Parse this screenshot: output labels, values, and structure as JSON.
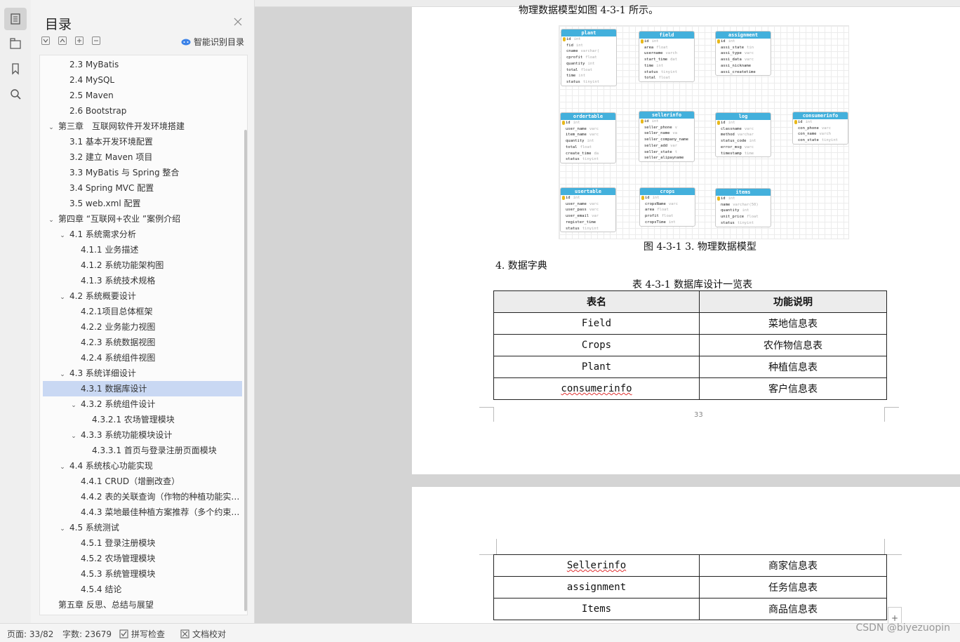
{
  "toc": {
    "title": "目录",
    "smart_label": "智能识别目录",
    "items": [
      {
        "label": "2.3 MyBatis",
        "level": 2,
        "expand": ""
      },
      {
        "label": "2.4 MySQL",
        "level": 2,
        "expand": ""
      },
      {
        "label": "2.5 Maven",
        "level": 2,
        "expand": ""
      },
      {
        "label": "2.6 Bootstrap",
        "level": 2,
        "expand": ""
      },
      {
        "label": "第三章　互联网软件开发环境搭建",
        "level": 1,
        "expand": "open"
      },
      {
        "label": "3.1  基本开发环境配置",
        "level": 2,
        "expand": ""
      },
      {
        "label": "3.2  建立 Maven 项目",
        "level": 2,
        "expand": ""
      },
      {
        "label": "3.3 MyBatis 与 Spring 整合",
        "level": 2,
        "expand": ""
      },
      {
        "label": "3.4   Spring MVC 配置",
        "level": 2,
        "expand": ""
      },
      {
        "label": "3.5 web.xml 配置",
        "level": 2,
        "expand": ""
      },
      {
        "label": "第四章  “互联网+农业 ”案例介绍",
        "level": 1,
        "expand": "open"
      },
      {
        "label": "4.1  系统需求分析",
        "level": 2,
        "expand": "open"
      },
      {
        "label": "4.1.1  业务描述",
        "level": 3,
        "expand": ""
      },
      {
        "label": "4.1.2  系统功能架构图",
        "level": 3,
        "expand": ""
      },
      {
        "label": "4.1.3  系统技术规格",
        "level": 3,
        "expand": ""
      },
      {
        "label": "4.2  系统概要设计",
        "level": 2,
        "expand": "open"
      },
      {
        "label": "4.2.1项目总体框架",
        "level": 3,
        "expand": ""
      },
      {
        "label": "4.2.2  业务能力视图",
        "level": 3,
        "expand": ""
      },
      {
        "label": "4.2.3  系统数据视图",
        "level": 3,
        "expand": ""
      },
      {
        "label": "4.2.4  系统组件视图",
        "level": 3,
        "expand": ""
      },
      {
        "label": "4.3  系统详细设计",
        "level": 2,
        "expand": "open"
      },
      {
        "label": "4.3.1  数据库设计",
        "level": 3,
        "expand": "",
        "selected": true
      },
      {
        "label": "4.3.2  系统组件设计",
        "level": 3,
        "expand": "open"
      },
      {
        "label": "4.3.2.1 农场管理模块",
        "level": 4,
        "expand": ""
      },
      {
        "label": "4.3.3  系统功能模块设计",
        "level": 3,
        "expand": "open"
      },
      {
        "label": "4.3.3.1 首页与登录注册页面模块",
        "level": 4,
        "expand": ""
      },
      {
        "label": "4.4  系统核心功能实现",
        "level": 2,
        "expand": "open"
      },
      {
        "label": "4.4.1 CRUD（增删改查）",
        "level": 3,
        "expand": ""
      },
      {
        "label": "4.4.2 表的关联查询（作物的种植功能实现）",
        "level": 3,
        "expand": ""
      },
      {
        "label": "4.4.3 菜地最佳种植方案推荐（多个约束条件）",
        "level": 3,
        "expand": ""
      },
      {
        "label": "4.5  系统测试",
        "level": 2,
        "expand": "open"
      },
      {
        "label": "4.5.1  登录注册模块",
        "level": 3,
        "expand": ""
      },
      {
        "label": "4.5.2 农场管理模块",
        "level": 3,
        "expand": ""
      },
      {
        "label": "4.5.3 系统管理模块",
        "level": 3,
        "expand": ""
      },
      {
        "label": "4.5.4 结论",
        "level": 3,
        "expand": ""
      },
      {
        "label": "第五章  反思、总结与展望",
        "level": 1,
        "expand": ""
      }
    ]
  },
  "doc": {
    "top_text": "物理数据模型如图 4-3-1 所示。",
    "figure_caption": "图 4-3-1 3. 物理数据模型",
    "section_heading": "4. 数据字典",
    "table_caption": "表 4-3-1 数据库设计一览表",
    "table_headers": [
      "表名",
      "功能说明"
    ],
    "table_rows_p1": [
      {
        "name": "Field",
        "desc": "菜地信息表"
      },
      {
        "name": "Crops",
        "desc": "农作物信息表"
      },
      {
        "name": "Plant",
        "desc": "种植信息表"
      },
      {
        "name": "consumerinfo",
        "desc": "客户信息表"
      }
    ],
    "table_rows_p2": [
      {
        "name": "Sellerinfo",
        "desc": "商家信息表"
      },
      {
        "name": "assignment",
        "desc": "任务信息表"
      },
      {
        "name": "Items",
        "desc": "商品信息表"
      }
    ],
    "page_number": "33",
    "er_tables": [
      {
        "name": "plant",
        "fields": [
          [
            "id",
            "int"
          ],
          [
            "fid",
            "int"
          ],
          [
            "cname",
            "varchar("
          ],
          [
            "cprofit",
            "float"
          ],
          [
            "quantity",
            "int"
          ],
          [
            "total",
            "float"
          ],
          [
            "time",
            "int"
          ],
          [
            "status",
            "tinyint"
          ]
        ]
      },
      {
        "name": "field",
        "fields": [
          [
            "id",
            "int"
          ],
          [
            "area",
            "float"
          ],
          [
            "username",
            "varch"
          ],
          [
            "start_time",
            "dat"
          ],
          [
            "time",
            "int"
          ],
          [
            "status",
            "tinyint"
          ],
          [
            "total",
            "float"
          ]
        ]
      },
      {
        "name": "assignment",
        "fields": [
          [
            "id",
            "int"
          ],
          [
            "assi_state",
            "tin"
          ],
          [
            "assi_type",
            "varc"
          ],
          [
            "assi_data",
            "varc"
          ],
          [
            "assi_nickname",
            ""
          ],
          [
            "assi_createtime",
            ""
          ]
        ]
      },
      {
        "name": "ordertable",
        "fields": [
          [
            "id",
            "int"
          ],
          [
            "user_name",
            "varc"
          ],
          [
            "item_name",
            "varc"
          ],
          [
            "quantity",
            "int"
          ],
          [
            "total",
            "float"
          ],
          [
            "create_time",
            "da"
          ],
          [
            "status",
            "tinyint"
          ]
        ]
      },
      {
        "name": "sellerinfo",
        "fields": [
          [
            "id",
            "int"
          ],
          [
            "seller_phone",
            "v"
          ],
          [
            "seller_name",
            "va"
          ],
          [
            "seller_company_name",
            ""
          ],
          [
            "seller_add",
            "var"
          ],
          [
            "seller_state",
            "t"
          ],
          [
            "seller_alipayname",
            ""
          ]
        ]
      },
      {
        "name": "log",
        "fields": [
          [
            "id",
            "int"
          ],
          [
            "classname",
            "varc"
          ],
          [
            "method",
            "varchar"
          ],
          [
            "status_code",
            "int"
          ],
          [
            "error_msg",
            "varc"
          ],
          [
            "timestamp",
            "time"
          ]
        ]
      },
      {
        "name": "consumerinfo",
        "fields": [
          [
            "id",
            "int"
          ],
          [
            "con_phone",
            "varc"
          ],
          [
            "con_name",
            "varch"
          ],
          [
            "con_state",
            "tinyint"
          ]
        ]
      },
      {
        "name": "usertable",
        "fields": [
          [
            "id",
            "int"
          ],
          [
            "user_name",
            "varc"
          ],
          [
            "user_pass",
            "varc"
          ],
          [
            "user_email",
            "var"
          ],
          [
            "register_time",
            ""
          ],
          [
            "status",
            "tinyint"
          ]
        ]
      },
      {
        "name": "crops",
        "fields": [
          [
            "id",
            "int"
          ],
          [
            "cropsName",
            "varc"
          ],
          [
            "area",
            "float"
          ],
          [
            "profit",
            "float"
          ],
          [
            "cropsTime",
            "int"
          ]
        ]
      },
      {
        "name": "items",
        "fields": [
          [
            "id",
            "int"
          ],
          [
            "name",
            "varchar(50)"
          ],
          [
            "quantity",
            "int"
          ],
          [
            "unit_price",
            "float"
          ],
          [
            "status",
            "tinyint"
          ]
        ]
      }
    ]
  },
  "status": {
    "page": "页面: 33/82",
    "words": "字数: 23679",
    "spell": "拼写检查",
    "proof": "文档校对",
    "watermark": "CSDN @biyezuopin"
  },
  "colors": {
    "er_header": "#43b0dc",
    "selection": "#c9d8f3"
  }
}
